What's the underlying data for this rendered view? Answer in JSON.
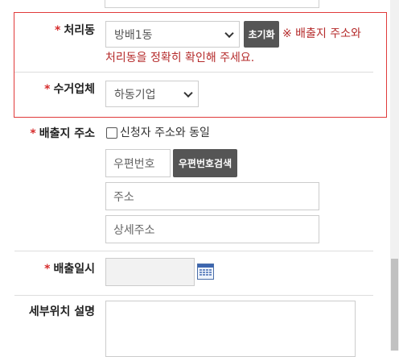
{
  "form": {
    "required_mark": "*",
    "area": {
      "label": "처리동",
      "selected": "방배1동",
      "reset_button": "초기화",
      "notice_line1": "※ 배출지 주소와",
      "notice_line2": "처리동을 정확히 확인해 주세요."
    },
    "company": {
      "label": "수거업체",
      "selected": "하동기업"
    },
    "address": {
      "label": "배출지 주소",
      "same_as_applicant": "신청자 주소와 동일",
      "postal_placeholder": "우편번호",
      "postal_search_button": "우편번호검색",
      "address_placeholder": "주소",
      "detail_placeholder": "상세주소"
    },
    "date": {
      "label": "배출일시"
    },
    "location_detail": {
      "label": "세부위치 설명"
    }
  },
  "colors": {
    "required": "#d62b2b",
    "notice": "#b52b2b",
    "frame": "#e03a3a",
    "button_bg": "#555555"
  }
}
